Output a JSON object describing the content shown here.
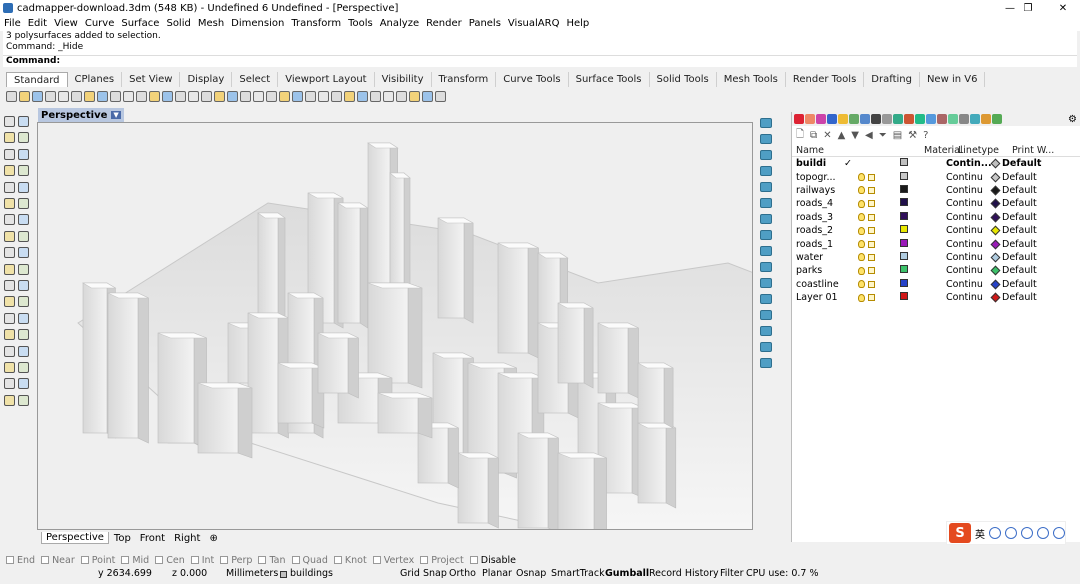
{
  "window": {
    "title": "cadmapper-download.3dm (548 KB) - Undefined 6 Undefined - [Perspective]",
    "minimize_glyph": "—",
    "maximize_glyph": "❐",
    "close_glyph": "✕"
  },
  "menu": [
    "File",
    "Edit",
    "View",
    "Curve",
    "Surface",
    "Solid",
    "Mesh",
    "Dimension",
    "Transform",
    "Tools",
    "Analyze",
    "Render",
    "Panels",
    "VisualARQ",
    "Help"
  ],
  "command": {
    "history_line1": "3 polysurfaces added to selection.",
    "history_line2": "Command: _Hide",
    "prompt": "Command:"
  },
  "toolbar_tabs": [
    "Standard",
    "CPlanes",
    "Set View",
    "Display",
    "Select",
    "Viewport Layout",
    "Visibility",
    "Transform",
    "Curve Tools",
    "Surface Tools",
    "Solid Tools",
    "Mesh Tools",
    "Render Tools",
    "Drafting",
    "New in V6"
  ],
  "viewport": {
    "title": "Perspective",
    "dropdown_glyph": "▼"
  },
  "view_tabs": [
    "Perspective",
    "Top",
    "Front",
    "Right"
  ],
  "add_view_glyph": "⊕",
  "layers": {
    "columns": {
      "name": "Name",
      "material": "Material",
      "linetype": "Linetype",
      "print_width": "Print W..."
    },
    "rows": [
      {
        "name": "buildi",
        "current": "✓",
        "linetype": "Contin...",
        "print": "Default",
        "color": "#c0c0c0",
        "bold": true
      },
      {
        "name": "topogr...",
        "linetype": "Continu",
        "print": "Default",
        "color": "#c8c8c8"
      },
      {
        "name": "railways",
        "linetype": "Continu",
        "print": "Default",
        "color": "#1a1a1a"
      },
      {
        "name": "roads_4",
        "linetype": "Continu",
        "print": "Default",
        "color": "#20104a"
      },
      {
        "name": "roads_3",
        "linetype": "Continu",
        "print": "Default",
        "color": "#30105a"
      },
      {
        "name": "roads_2",
        "linetype": "Continu",
        "print": "Default",
        "color": "#e8e800"
      },
      {
        "name": "roads_1",
        "linetype": "Continu",
        "print": "Default",
        "color": "#9a1ab8"
      },
      {
        "name": "water",
        "linetype": "Continu",
        "print": "Default",
        "color": "#b0cce0"
      },
      {
        "name": "parks",
        "linetype": "Continu",
        "print": "Default",
        "color": "#3cc26a"
      },
      {
        "name": "coastline",
        "linetype": "Continu",
        "print": "Default",
        "color": "#2642c8"
      },
      {
        "name": "Layer 01",
        "linetype": "Continu",
        "print": "Default",
        "color": "#d01818"
      }
    ]
  },
  "osnaps": [
    {
      "label": "End",
      "on": false
    },
    {
      "label": "Near",
      "on": false
    },
    {
      "label": "Point",
      "on": false
    },
    {
      "label": "Mid",
      "on": false
    },
    {
      "label": "Cen",
      "on": false
    },
    {
      "label": "Int",
      "on": false
    },
    {
      "label": "Perp",
      "on": false
    },
    {
      "label": "Tan",
      "on": false
    },
    {
      "label": "Quad",
      "on": false
    },
    {
      "label": "Knot",
      "on": false
    },
    {
      "label": "Vertex",
      "on": false
    },
    {
      "label": "Project",
      "on": false
    },
    {
      "label": "Disable",
      "on": true
    }
  ],
  "status": {
    "y": "y 2634.699",
    "z": "z 0.000",
    "units": "Millimeters",
    "layer": "buildings",
    "grid_snap": "Grid Snap",
    "ortho": "Ortho",
    "planar": "Planar",
    "osnap": "Osnap",
    "smarttrack": "SmartTrack",
    "gumball": "Gumball",
    "record_history": "Record History",
    "filter": "Filter",
    "cpu": "CPU use: 0.7 %"
  },
  "ime": {
    "logo": "S",
    "lang": "英"
  },
  "colors": {
    "selection_blue": "#b8c7e0",
    "panel_icon": "#4f9ec4"
  }
}
